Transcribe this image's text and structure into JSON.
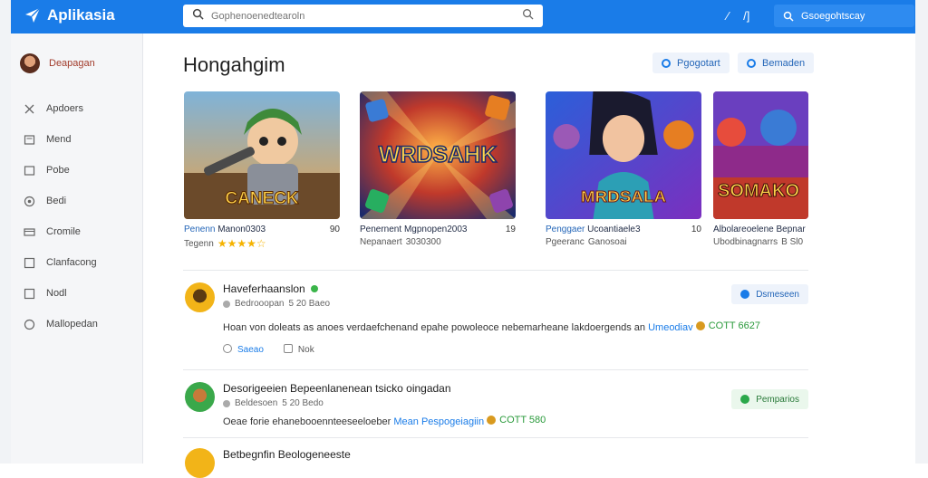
{
  "app": {
    "name": "Aplikasia"
  },
  "search": {
    "placeholder": "Gophenoenedtearoln"
  },
  "topbar": {
    "icon1": "⁄",
    "icon2": "/]",
    "user_label": "Gsoegohtscay"
  },
  "sidebar": {
    "profile_name": "Deapagan",
    "items": [
      {
        "label": "Apdoers",
        "icon": "close-icon"
      },
      {
        "label": "Mend",
        "icon": "square-icon"
      },
      {
        "label": "Pobe",
        "icon": "square-icon"
      },
      {
        "label": "Bedi",
        "icon": "circle-icon"
      },
      {
        "label": "Cromile",
        "icon": "card-icon"
      },
      {
        "label": "Clanfacong",
        "icon": "square-icon"
      },
      {
        "label": "Nodl",
        "icon": "square-icon"
      },
      {
        "label": "Mallopedan",
        "icon": "circle-icon"
      }
    ]
  },
  "main": {
    "title": "Hongahgim",
    "buttons": [
      {
        "label": "Pgogotart"
      },
      {
        "label": "Bemaden"
      }
    ],
    "cards": [
      {
        "thumb_text": "CANECK",
        "title_a": "Penenn",
        "title_b": "Manon0303",
        "count": "90",
        "sub": "Tegenn",
        "rating": 4.5
      },
      {
        "thumb_text": "WRDSAHK",
        "title_a": "Penernent",
        "title_b": "Mgpnopen2003",
        "count": "19",
        "sub": "Nepanaert",
        "sub_b": "3030300",
        "rating": null
      },
      {
        "thumb_text": "MRDSALA",
        "title_a": "Penggaer",
        "title_b": "Ucoantiaele3",
        "count": "10",
        "sub": "Pgeeranc",
        "sub_b": "Ganosoai",
        "rating": null
      },
      {
        "thumb_text": "SOMAKO",
        "title_a": "Albolareoelene",
        "title_b": "Bepnar",
        "count": "",
        "sub": "Ubodbinagnarrs",
        "sub_b": "B Sl0",
        "rating": null
      }
    ],
    "posts": [
      {
        "title": "Haveferhaanslon",
        "meta_a": "Bedrooopan",
        "meta_b": "5 20 Baeo",
        "body": "Hoan von doleats as anoes verdaefchenand epahe powoleoce nebemarheane lakdoergends an",
        "link": "Umeodiav",
        "coin": "COTT 6627",
        "action_a": "Saeao",
        "action_b": "Nok",
        "button": "Dsmeseen"
      },
      {
        "title": "Desorigeeien Bepeenlanenean tsicko oingadan",
        "meta_a": "Beldesoen",
        "meta_b": "5 20 Bedo",
        "body": "Oeae forie ehanebooennteeseeloeber",
        "link": "Mean Pespogeiagiin",
        "coin": "COTT 580",
        "button": "Pemparios"
      },
      {
        "title": "Betbegnfin Beologeneeste"
      }
    ]
  },
  "colors": {
    "brand": "#1a7ce8",
    "accent_green": "#2aa84a"
  }
}
